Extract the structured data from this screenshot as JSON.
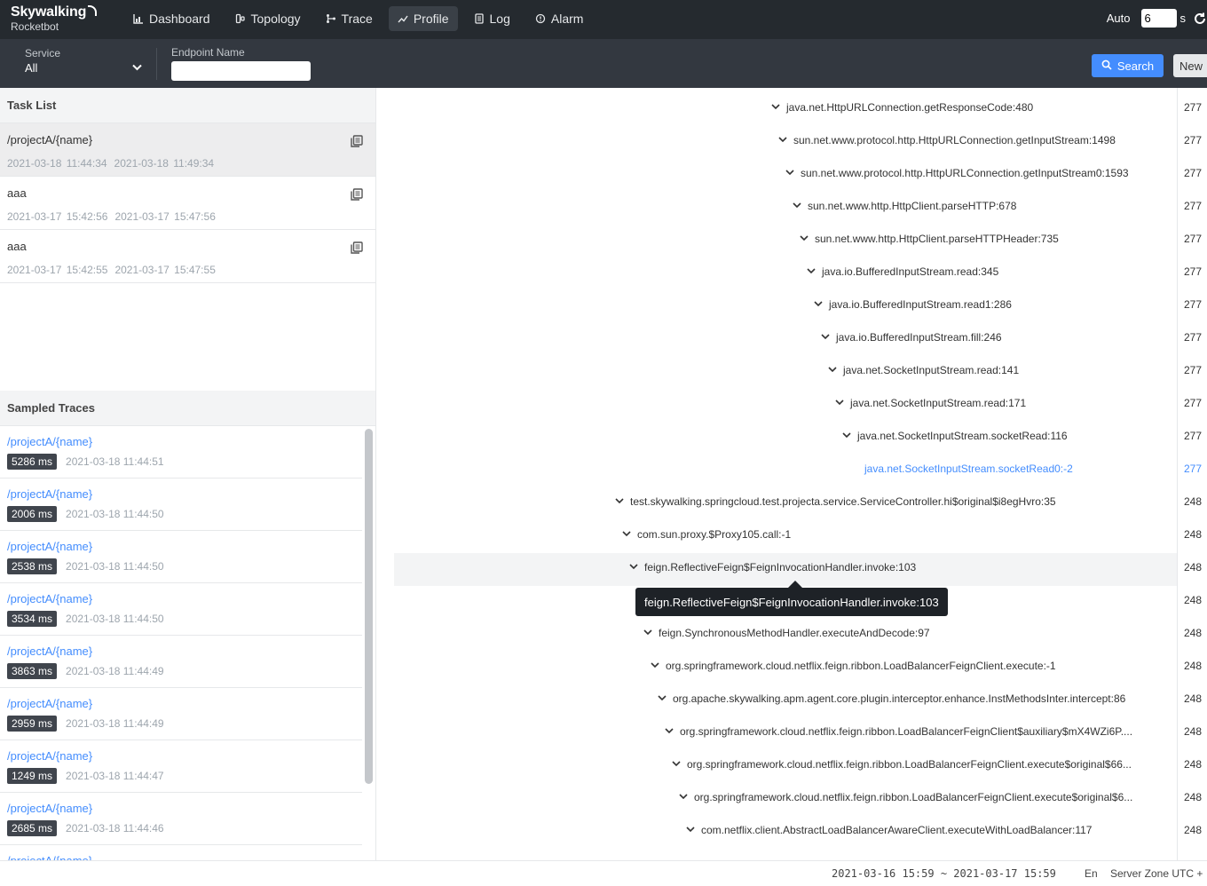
{
  "app": {
    "brand": "Skywalking",
    "subtitle": "Rocketbot"
  },
  "nav": [
    {
      "label": "Dashboard",
      "icon": "dashboard-icon"
    },
    {
      "label": "Topology",
      "icon": "topology-icon"
    },
    {
      "label": "Trace",
      "icon": "trace-icon"
    },
    {
      "label": "Profile",
      "icon": "profile-icon",
      "active": true
    },
    {
      "label": "Log",
      "icon": "log-icon"
    },
    {
      "label": "Alarm",
      "icon": "alarm-icon"
    }
  ],
  "auto": {
    "label": "Auto",
    "value": "6",
    "unit": "s"
  },
  "toolbar": {
    "service_label": "Service",
    "service_value": "All",
    "endpoint_label": "Endpoint Name",
    "endpoint_value": "",
    "search_label": "Search",
    "new_label": "New"
  },
  "task_list": {
    "title": "Task List",
    "items": [
      {
        "name": "/projectA/{name}",
        "start": "2021-03-18 11:44:34",
        "end": "2021-03-18 11:49:34"
      },
      {
        "name": "aaa",
        "start": "2021-03-17 15:42:56",
        "end": "2021-03-17 15:47:56"
      },
      {
        "name": "aaa",
        "start": "2021-03-17 15:42:55",
        "end": "2021-03-17 15:47:55"
      }
    ]
  },
  "sampled_traces": {
    "title": "Sampled Traces",
    "items": [
      {
        "name": "/projectA/{name}",
        "duration": "5286 ms",
        "time": "2021-03-18 11:44:51"
      },
      {
        "name": "/projectA/{name}",
        "duration": "2006 ms",
        "time": "2021-03-18 11:44:50"
      },
      {
        "name": "/projectA/{name}",
        "duration": "2538 ms",
        "time": "2021-03-18 11:44:50"
      },
      {
        "name": "/projectA/{name}",
        "duration": "3534 ms",
        "time": "2021-03-18 11:44:50"
      },
      {
        "name": "/projectA/{name}",
        "duration": "3863 ms",
        "time": "2021-03-18 11:44:49"
      },
      {
        "name": "/projectA/{name}",
        "duration": "2959 ms",
        "time": "2021-03-18 11:44:49"
      },
      {
        "name": "/projectA/{name}",
        "duration": "1249 ms",
        "time": "2021-03-18 11:44:47"
      },
      {
        "name": "/projectA/{name}",
        "duration": "2685 ms",
        "time": "2021-03-18 11:44:46"
      },
      {
        "name": "/projectA/{name}",
        "duration": "",
        "time": ""
      }
    ]
  },
  "tree": {
    "rows": [
      {
        "text": "java.net.HttpURLConnection.getResponseCode:480",
        "count": "277",
        "depth": 0,
        "caret": true
      },
      {
        "text": "sun.net.www.protocol.http.HttpURLConnection.getInputStream:1498",
        "count": "277",
        "depth": 1,
        "caret": true
      },
      {
        "text": "sun.net.www.protocol.http.HttpURLConnection.getInputStream0:1593",
        "count": "277",
        "depth": 2,
        "caret": true
      },
      {
        "text": "sun.net.www.http.HttpClient.parseHTTP:678",
        "count": "277",
        "depth": 3,
        "caret": true
      },
      {
        "text": "sun.net.www.http.HttpClient.parseHTTPHeader:735",
        "count": "277",
        "depth": 4,
        "caret": true
      },
      {
        "text": "java.io.BufferedInputStream.read:345",
        "count": "277",
        "depth": 5,
        "caret": true
      },
      {
        "text": "java.io.BufferedInputStream.read1:286",
        "count": "277",
        "depth": 6,
        "caret": true
      },
      {
        "text": "java.io.BufferedInputStream.fill:246",
        "count": "277",
        "depth": 7,
        "caret": true
      },
      {
        "text": "java.net.SocketInputStream.read:141",
        "count": "277",
        "depth": 8,
        "caret": true
      },
      {
        "text": "java.net.SocketInputStream.read:171",
        "count": "277",
        "depth": 9,
        "caret": true
      },
      {
        "text": "java.net.SocketInputStream.socketRead:116",
        "count": "277",
        "depth": 10,
        "caret": true
      },
      {
        "text": "java.net.SocketInputStream.socketRead0:-2",
        "count": "277",
        "depth": 11,
        "caret": false,
        "link": true
      },
      {
        "text": "test.skywalking.springcloud.test.projecta.service.ServiceController.hi$original$i8egHvro:35",
        "count": "248",
        "depth": -22,
        "caret": true
      },
      {
        "text": "com.sun.proxy.$Proxy105.call:-1",
        "count": "248",
        "depth": -21,
        "caret": true
      },
      {
        "text": "feign.ReflectiveFeign$FeignInvocationHandler.invoke:103",
        "count": "248",
        "depth": -20,
        "caret": true
      },
      {
        "text": "",
        "count": "248",
        "depth": -19,
        "caret": false
      },
      {
        "text": "feign.SynchronousMethodHandler.executeAndDecode:97",
        "count": "248",
        "depth": -18,
        "caret": true
      },
      {
        "text": "org.springframework.cloud.netflix.feign.ribbon.LoadBalancerFeignClient.execute:-1",
        "count": "248",
        "depth": -17,
        "caret": true
      },
      {
        "text": "org.apache.skywalking.apm.agent.core.plugin.interceptor.enhance.InstMethodsInter.intercept:86",
        "count": "248",
        "depth": -16,
        "caret": true
      },
      {
        "text": "org.springframework.cloud.netflix.feign.ribbon.LoadBalancerFeignClient$auxiliary$mX4WZi6P....",
        "count": "248",
        "depth": -15,
        "caret": true
      },
      {
        "text": "org.springframework.cloud.netflix.feign.ribbon.LoadBalancerFeignClient.execute$original$66...",
        "count": "248",
        "depth": -14,
        "caret": true
      },
      {
        "text": "org.springframework.cloud.netflix.feign.ribbon.LoadBalancerFeignClient.execute$original$6...",
        "count": "248",
        "depth": -13,
        "caret": true
      },
      {
        "text": "com.netflix.client.AbstractLoadBalancerAwareClient.executeWithLoadBalancer:117",
        "count": "248",
        "depth": -12,
        "caret": true
      }
    ],
    "tooltip": "feign.ReflectiveFeign$FeignInvocationHandler.invoke:103"
  },
  "footer": {
    "range": "2021-03-16 15:59 ~ 2021-03-17 15:59",
    "lang": "En",
    "zone": "Server Zone UTC +"
  }
}
